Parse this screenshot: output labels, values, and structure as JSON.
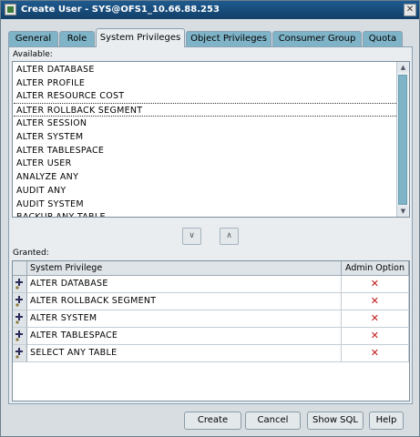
{
  "window": {
    "title": "Create User - SYS@OFS1_10.66.88.253"
  },
  "tabs": [
    {
      "label": "General"
    },
    {
      "label": "Role"
    },
    {
      "label": "System Privileges"
    },
    {
      "label": "Object Privileges"
    },
    {
      "label": "Consumer Group"
    },
    {
      "label": "Quota"
    }
  ],
  "active_tab": "System Privileges",
  "available": {
    "label": "Available:",
    "items": [
      "ALTER DATABASE",
      "ALTER PROFILE",
      "ALTER RESOURCE COST",
      "ALTER ROLLBACK SEGMENT",
      "ALTER SESSION",
      "ALTER SYSTEM",
      "ALTER TABLESPACE",
      "ALTER USER",
      "ANALYZE ANY",
      "AUDIT ANY",
      "AUDIT SYSTEM",
      "BACKUP ANY TABLE"
    ],
    "focused_item": "ALTER ROLLBACK SEGMENT"
  },
  "granted": {
    "label": "Granted:",
    "columns": [
      "System Privilege",
      "Admin Option"
    ],
    "rows": [
      {
        "privilege": "ALTER DATABASE",
        "admin": "✕"
      },
      {
        "privilege": "ALTER ROLLBACK SEGMENT",
        "admin": "✕"
      },
      {
        "privilege": "ALTER SYSTEM",
        "admin": "✕"
      },
      {
        "privilege": "ALTER TABLESPACE",
        "admin": "✕"
      },
      {
        "privilege": "SELECT ANY TABLE",
        "admin": "✕"
      }
    ]
  },
  "buttons": {
    "create": "Create",
    "cancel": "Cancel",
    "show_sql": "Show SQL",
    "help": "Help"
  },
  "colors": {
    "title_bar": "#1f5a8f",
    "tab_inactive": "#7fb3c7",
    "admin_x": "#c0181b"
  }
}
